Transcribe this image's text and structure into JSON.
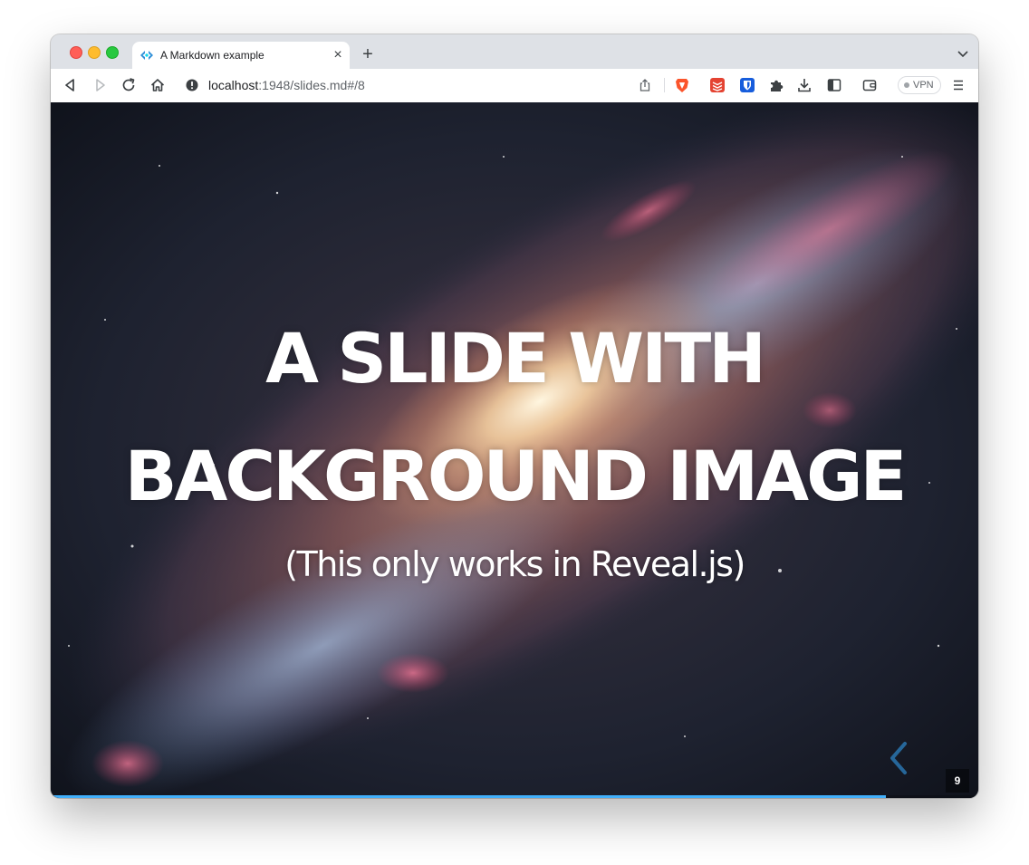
{
  "browser": {
    "tab": {
      "title": "A Markdown example",
      "close_label": "×"
    },
    "new_tab_label": "+",
    "address_bar": {
      "host": "localhost",
      "path": ":1948/slides.md#/8"
    },
    "vpn_label": "VPN",
    "colors": {
      "accent": "#42affa",
      "traffic_close": "#ff5f57",
      "traffic_min": "#febc2e",
      "traffic_max": "#28c840"
    },
    "icons": [
      "back-icon",
      "forward-icon",
      "reload-icon",
      "home-icon",
      "info-icon",
      "share-icon",
      "brave-icon",
      "todoist-icon",
      "bitwarden-icon",
      "extensions-icon",
      "download-icon",
      "sidebar-icon",
      "wallet-icon",
      "menu-icon",
      "tab-search-icon"
    ]
  },
  "slide": {
    "title_line1": "A SLIDE WITH",
    "title_line2": "BACKGROUND IMAGE",
    "subtitle": "(This only works in Reveal.js)",
    "slide_number": "9",
    "progress": 0.9
  }
}
